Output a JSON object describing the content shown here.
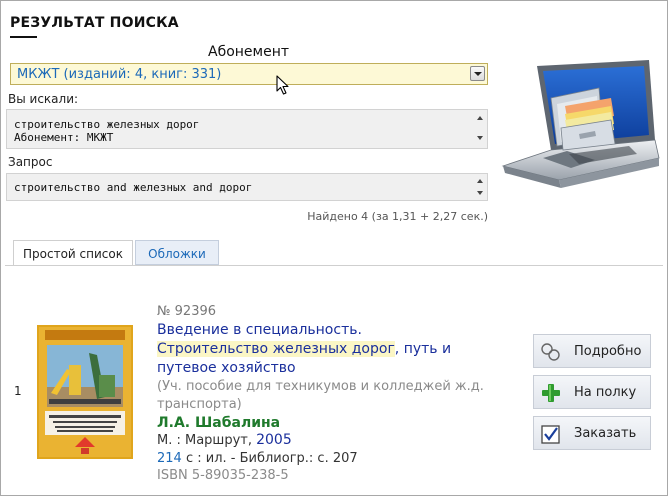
{
  "page": {
    "title": "РЕЗУЛЬТАТ ПОИСКА"
  },
  "subscription": {
    "label": "Абонемент",
    "selected": "МКЖТ (изданий: 4, книг: 331)"
  },
  "searched": {
    "label": "Вы искали:",
    "line1": "строительство железных дорог",
    "line2": "Абонемент: МКЖТ"
  },
  "query": {
    "label": "Запрос",
    "text": "строительство and железных and дорог"
  },
  "found": "Найдено 4 (за 1,31 + 2,27 сек.)",
  "tabs": {
    "simple": "Простой список",
    "covers": "Обложки"
  },
  "result": {
    "index": "1",
    "number": "№ 92396",
    "title_line1": "Введение в специальность.",
    "title_highlight": "Строительство железных дорог",
    "title_rest": ", путь и",
    "title_line3": "путевое хозяйство",
    "note_line1": "(Уч. пособие для техникумов и колледжей ж.д.",
    "note_line2": "транспорта)",
    "author": "Л.А. Шабалина",
    "publisher": "М. : Маршрут, ",
    "year": "2005",
    "pages": "214",
    "pages_rest": " с : ил. - Библиогр.: с. 207",
    "isbn": "ISBN 5-89035-238-5",
    "cover_title": "ВВЕДЕНИЕ В СПЕЦИАЛЬНОСТЬ. СТРОИТЕЛЬСТВО ЖЕЛЕЗНЫХ ДОРОГ, ПУТЬ И ПУТЕВОЕ ХОЗЯЙСТВО"
  },
  "actions": {
    "details": "Подробно",
    "shelf": "На полку",
    "order": "Заказать"
  },
  "colors": {
    "link": "#1a2f9c",
    "author": "#1f7a2c",
    "select_bg": "#fdf9d6",
    "highlight": "#fbf6c5"
  },
  "icons": [
    "cursor-icon",
    "laptop-catalog-icon",
    "glasses-icon",
    "plus-icon",
    "checkbox-icon",
    "book-cover-image"
  ]
}
